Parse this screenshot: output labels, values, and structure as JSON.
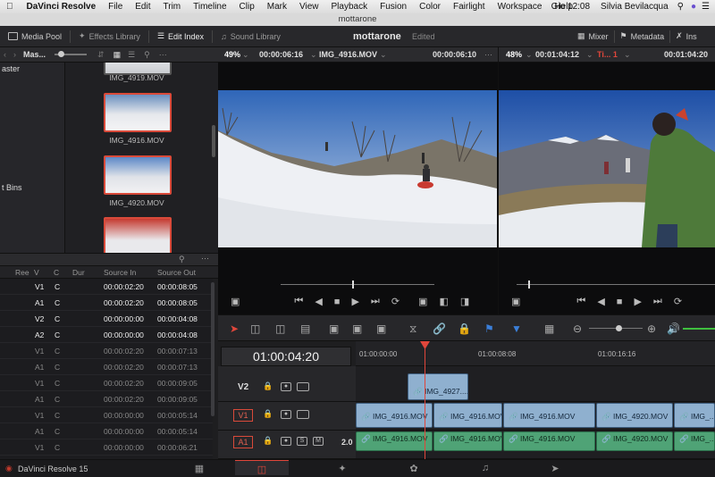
{
  "mac_menu": {
    "app": "DaVinci Resolve",
    "items": [
      "File",
      "Edit",
      "Trim",
      "Timeline",
      "Clip",
      "Mark",
      "View",
      "Playback",
      "Fusion",
      "Color",
      "Fairlight",
      "Workspace",
      "Help"
    ],
    "clock": "Gio 12:08",
    "user": "Silvia Bevilacqua"
  },
  "window_title": "mottarone",
  "toolbar": {
    "media_pool": "Media Pool",
    "effects_library": "Effects Library",
    "edit_index": "Edit Index",
    "sound_library": "Sound Library",
    "project_name": "mottarone",
    "project_status": "Edited",
    "mixer": "Mixer",
    "metadata": "Metadata",
    "inspector": "Ins"
  },
  "media_pool": {
    "bin_path": "Mas...",
    "bins": [
      "aster",
      "t Bins"
    ],
    "clips": [
      "IMG_4919.MOV",
      "IMG_4916.MOV",
      "IMG_4920.MOV"
    ]
  },
  "edit_index": {
    "columns": [
      "Ree",
      "V",
      "C",
      "Dur",
      "Source In",
      "Source Out"
    ],
    "rows": [
      {
        "v": "V1",
        "c": "C",
        "in": "00:00:02:20",
        "out": "00:00:08:05",
        "active": true
      },
      {
        "v": "A1",
        "c": "C",
        "in": "00:00:02:20",
        "out": "00:00:08:05",
        "active": true
      },
      {
        "v": "V2",
        "c": "C",
        "in": "00:00:00:00",
        "out": "00:00:04:08",
        "active": true
      },
      {
        "v": "A2",
        "c": "C",
        "in": "00:00:00:00",
        "out": "00:00:04:08",
        "active": true
      },
      {
        "v": "V1",
        "c": "C",
        "in": "00:00:02:20",
        "out": "00:00:07:13",
        "active": false
      },
      {
        "v": "A1",
        "c": "C",
        "in": "00:00:02:20",
        "out": "00:00:07:13",
        "active": false
      },
      {
        "v": "V1",
        "c": "C",
        "in": "00:00:02:20",
        "out": "00:00:09:05",
        "active": false
      },
      {
        "v": "A1",
        "c": "C",
        "in": "00:00:02:20",
        "out": "00:00:09:05",
        "active": false
      },
      {
        "v": "V1",
        "c": "C",
        "in": "00:00:00:00",
        "out": "00:00:05:14",
        "active": false
      },
      {
        "v": "A1",
        "c": "C",
        "in": "00:00:00:00",
        "out": "00:00:05:14",
        "active": false
      },
      {
        "v": "V1",
        "c": "C",
        "in": "00:00:00:00",
        "out": "00:00:06:21",
        "active": false
      }
    ]
  },
  "source_viewer": {
    "zoom": "49%",
    "duration": "00:00:06:16",
    "clip": "IMG_4916.MOV",
    "timecode": "00:00:06:10"
  },
  "timeline_viewer": {
    "zoom": "48%",
    "duration": "00:01:04:12",
    "timeline": "Ti... 1",
    "timecode": "00:01:04:20"
  },
  "timeline": {
    "current_tc": "01:00:04:20",
    "ruler": [
      "01:00:00:00",
      "01:00:08:08",
      "01:00:16:16"
    ],
    "tracks": {
      "v2": {
        "name": "V2",
        "clips": [
          "IMG_4927...."
        ]
      },
      "v1": {
        "name": "V1",
        "clips": [
          "IMG_4916.MOV",
          "IMG_4916.MOV",
          "IMG_4916.MOV",
          "IMG_4920.MOV",
          "IMG_..."
        ]
      },
      "a1": {
        "name": "A1",
        "level": "2.0",
        "solo": "S",
        "mute": "M",
        "clips": [
          "IMG_4916.MOV",
          "IMG_4916.MOV",
          "IMG_4916.MOV",
          "IMG_4920.MOV",
          "IMG_..."
        ]
      }
    }
  },
  "status": {
    "app_version": "DaVinci Resolve 15"
  },
  "colors": {
    "accent_red": "#d94a3a",
    "video_clip": "#8fb0cf",
    "audio_clip": "#4fa376",
    "panel": "#28282b"
  }
}
